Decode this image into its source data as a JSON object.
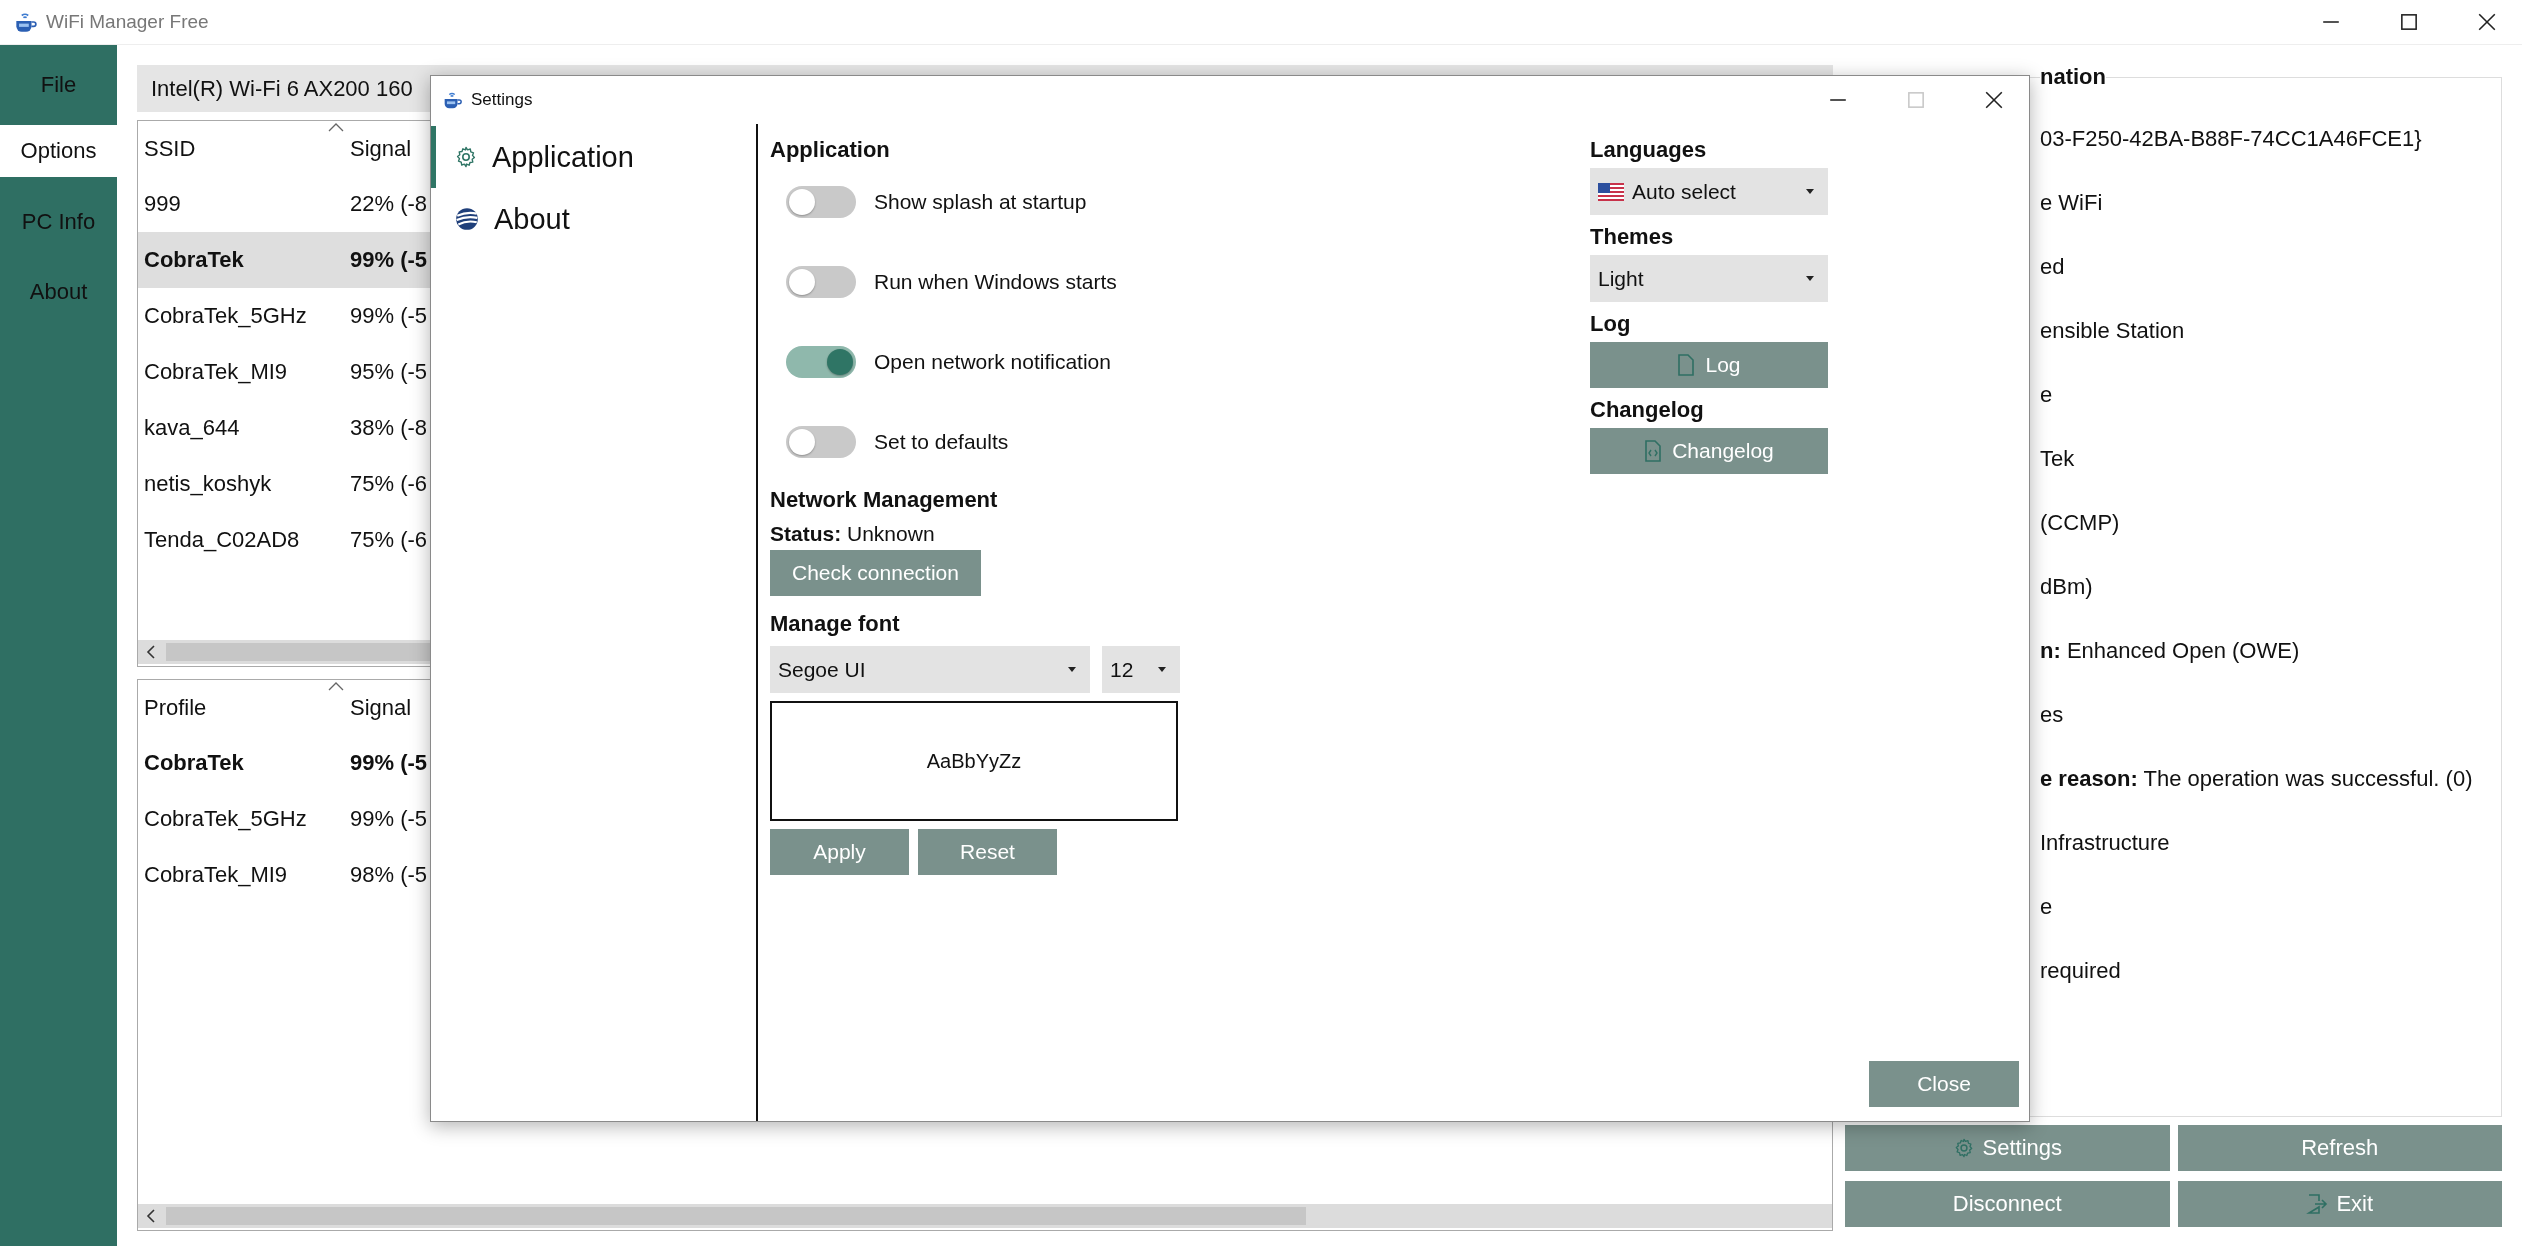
{
  "window": {
    "title": "WiFi Manager Free"
  },
  "nav": [
    {
      "label": "File",
      "selected": false
    },
    {
      "label": "Options",
      "selected": true
    },
    {
      "label": "PC Info",
      "selected": false
    },
    {
      "label": "About",
      "selected": false
    }
  ],
  "adapter": {
    "value": "Intel(R) Wi-Fi 6 AX200 160"
  },
  "networks": {
    "columns": [
      "SSID",
      "Signal"
    ],
    "rows": [
      {
        "ssid": "999",
        "signal": "22% (-8",
        "selected": false,
        "connected": false
      },
      {
        "ssid": "CobraTek",
        "signal": "99% (-5",
        "selected": true,
        "connected": true
      },
      {
        "ssid": "CobraTek_5GHz",
        "signal": "99% (-5",
        "selected": false,
        "connected": false
      },
      {
        "ssid": "CobraTek_MI9",
        "signal": "95% (-5",
        "selected": false,
        "connected": false
      },
      {
        "ssid": "kava_644",
        "signal": "38% (-8",
        "selected": false,
        "connected": false
      },
      {
        "ssid": "netis_koshyk",
        "signal": "75% (-6",
        "selected": false,
        "connected": false
      },
      {
        "ssid": "Tenda_C02AD8",
        "signal": "75% (-6",
        "selected": false,
        "connected": false
      }
    ]
  },
  "profiles": {
    "columns": [
      "Profile",
      "Signal"
    ],
    "rows": [
      {
        "profile": "CobraTek",
        "signal": "99% (-5",
        "connected": true
      },
      {
        "profile": "CobraTek_5GHz",
        "signal": "99% (-5",
        "connected": false
      },
      {
        "profile": "CobraTek_MI9",
        "signal": "98% (-5",
        "connected": false
      }
    ]
  },
  "info": {
    "title": "nation",
    "rows": [
      "03-F250-42BA-B88F-74CC1A46FCE1}",
      "e WiFi",
      "ed",
      "ensible Station",
      "e",
      "Tek",
      "(CCMP)",
      "dBm)",
      "**n:** Enhanced Open (OWE)",
      "es",
      "**e reason:** The operation was successful. (0)",
      "Infrastructure",
      "e",
      "required"
    ]
  },
  "buttons": [
    {
      "label": "Settings"
    },
    {
      "label": "Refresh"
    },
    {
      "label": "Disconnect"
    },
    {
      "label": "Exit"
    }
  ],
  "settings_dialog": {
    "title": "Settings",
    "nav": [
      {
        "label": "Application",
        "selected": true
      },
      {
        "label": "About",
        "selected": false
      }
    ],
    "application": {
      "heading": "Application",
      "toggles": [
        {
          "label": "Show splash at startup",
          "on": false
        },
        {
          "label": "Run when Windows starts",
          "on": false
        },
        {
          "label": "Open network notification",
          "on": true
        },
        {
          "label": "Set to defaults",
          "on": false
        }
      ]
    },
    "network": {
      "heading": "Network Management",
      "status": "**Status:** Unknown",
      "button": "Check connection"
    },
    "font": {
      "heading": "Manage font",
      "family": "Segoe UI",
      "size": "12",
      "preview": "AaBbYyZz",
      "buttons": [
        "Apply",
        "Reset"
      ]
    },
    "languages": {
      "heading": "Languages",
      "value": "Auto select"
    },
    "themes": {
      "heading": "Themes",
      "value": "Light"
    },
    "log": {
      "heading": "Log",
      "button": "Log"
    },
    "changelog": {
      "heading": "Changelog",
      "button": "Changelog"
    },
    "close_button": "Close"
  }
}
